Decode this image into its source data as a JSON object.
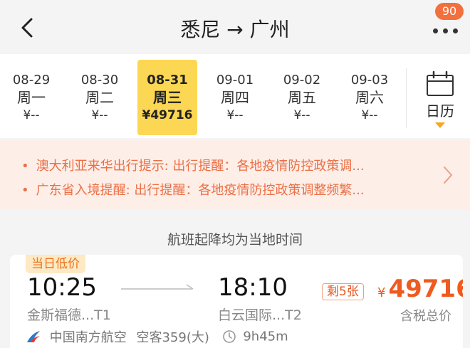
{
  "header": {
    "title": "悉尼 → 广州",
    "badge": "90"
  },
  "dates": [
    {
      "date": "08-29",
      "weekday": "周一",
      "price": "¥--",
      "selected": false
    },
    {
      "date": "08-30",
      "weekday": "周二",
      "price": "¥--",
      "selected": false
    },
    {
      "date": "08-31",
      "weekday": "周三",
      "price": "¥49716",
      "selected": true
    },
    {
      "date": "09-01",
      "weekday": "周四",
      "price": "¥--",
      "selected": false
    },
    {
      "date": "09-02",
      "weekday": "周五",
      "price": "¥--",
      "selected": false
    },
    {
      "date": "09-03",
      "weekday": "周六",
      "price": "¥--",
      "selected": false
    }
  ],
  "calendar": {
    "label": "日历"
  },
  "notices": [
    "澳大利亚来华出行提示: 出行提醒：各地疫情防控政策调...",
    "广东省入境提醒: 出行提醒：各地疫情防控政策调整频繁..."
  ],
  "subtitle": "航班起降均为当地时间",
  "flight": {
    "tag": "当日低价",
    "dep_time": "10:25",
    "arr_time": "18:10",
    "dep_airport": "金斯福德...T1",
    "arr_airport": "白云国际...T2",
    "seats": "剩5张",
    "currency": "¥",
    "price": "49716",
    "price_note": "含税总价",
    "airline": "中国南方航空",
    "aircraft": "空客359(大)",
    "duration": "9h45m"
  },
  "colors": {
    "accent": "#ef5a1f",
    "selected_bg": "#fcd753",
    "notice_bg": "#fdeee8",
    "notice_text": "#ec6f45"
  },
  "icons": [
    "back-arrow-icon",
    "more-dots-icon",
    "calendar-icon",
    "chevron-right-icon",
    "flight-arrow-icon",
    "china-southern-logo-icon",
    "clock-icon"
  ]
}
